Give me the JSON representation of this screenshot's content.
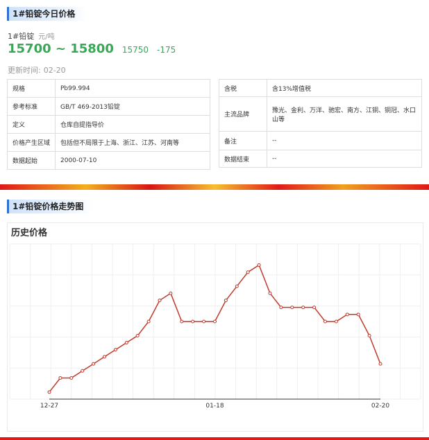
{
  "section1": {
    "title": "1#铅锭今日价格"
  },
  "product": {
    "name": "1#铅锭",
    "unit": "元/吨"
  },
  "price": {
    "range": "15700 ~ 15800",
    "mid": "15750",
    "change": "-175"
  },
  "update": {
    "label": "更新时间:",
    "value": "02-20"
  },
  "info_left": [
    {
      "key": "规格",
      "value": "Pb99.994"
    },
    {
      "key": "参考标准",
      "value": "GB/T 469-2013铅锭"
    },
    {
      "key": "定义",
      "value": "仓库自提指导价"
    },
    {
      "key": "价格产生区域",
      "value": "包括但不局限于上海、浙江、江苏、河南等"
    },
    {
      "key": "数据起始",
      "value": "2000-07-10"
    }
  ],
  "info_right": [
    {
      "key": "含税",
      "value": "含13%增值税"
    },
    {
      "key": "主流品牌",
      "value": "豫光、金利、万洋、驰宏、南方、江铜、铜冠、水口山等"
    },
    {
      "key": "备注",
      "value": "--"
    },
    {
      "key": "数据结束",
      "value": "--"
    }
  ],
  "section2": {
    "title": "1#铅锭价格走势图"
  },
  "chart_data": {
    "type": "line",
    "title": "历史价格",
    "x_tick_labels": [
      "12-27",
      "01-18",
      "02-20"
    ],
    "values": [
      15400,
      15500,
      15500,
      15550,
      15600,
      15650,
      15700,
      15750,
      15800,
      15900,
      16050,
      16100,
      15900,
      15900,
      15900,
      15900,
      16050,
      16150,
      16250,
      16300,
      16100,
      16000,
      16000,
      16000,
      16000,
      15900,
      15900,
      15950,
      15950,
      15800,
      15600
    ],
    "ylim": [
      15350,
      16450
    ],
    "grid": true,
    "color": "#c0392b",
    "legend": "none"
  }
}
